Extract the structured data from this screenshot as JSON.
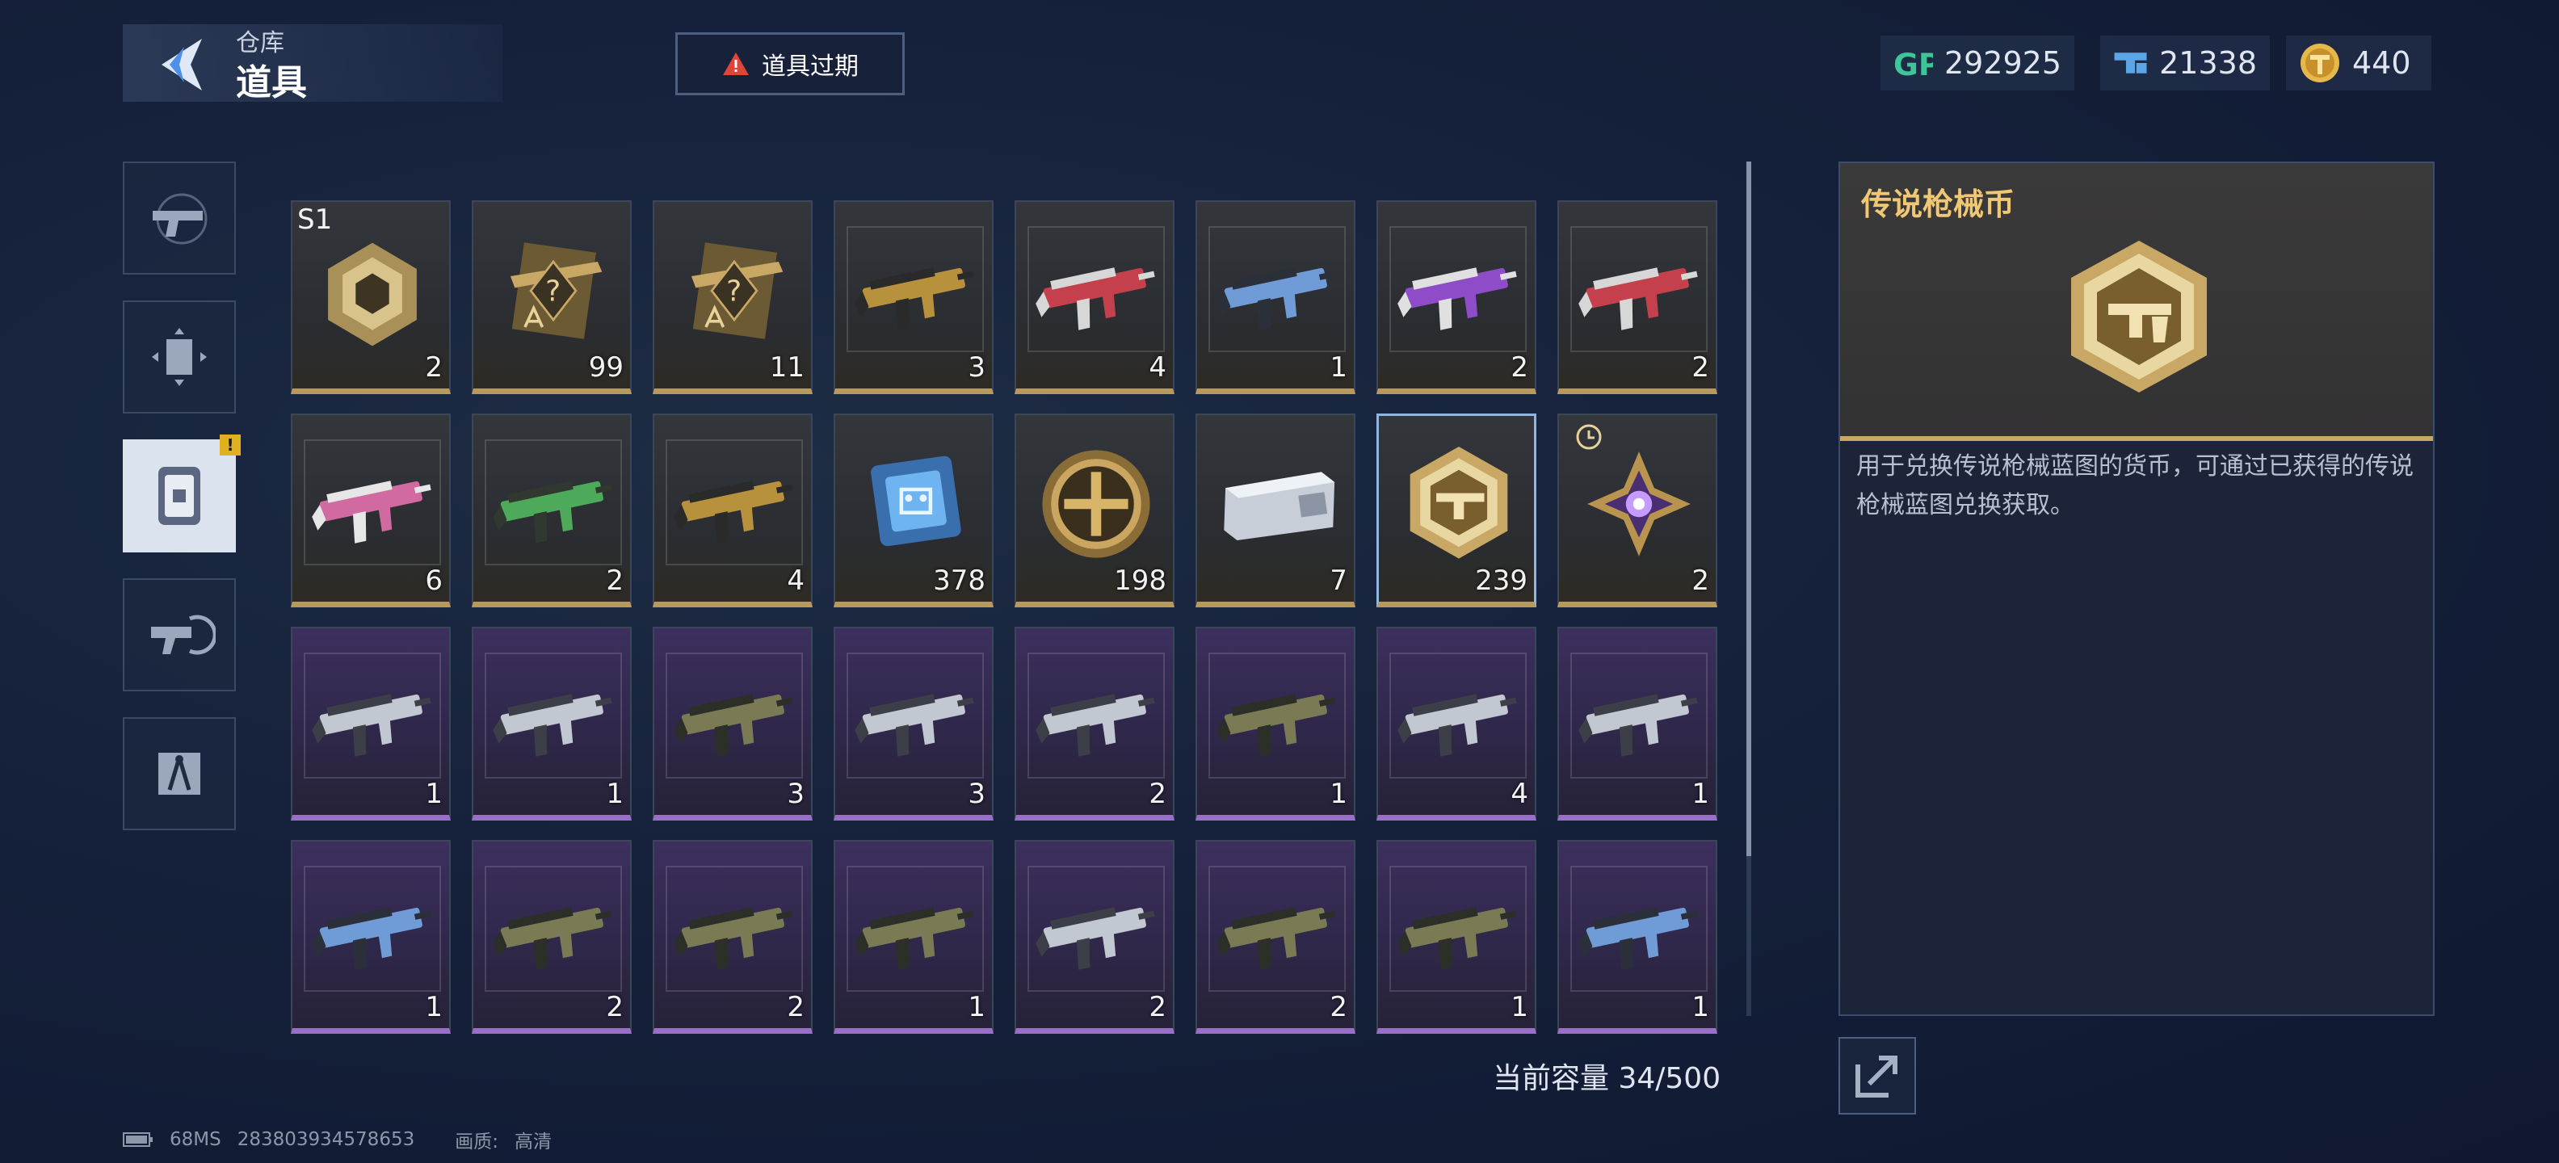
{
  "header": {
    "subtitle": "仓库",
    "title": "道具",
    "expire_button": "道具过期"
  },
  "currencies": [
    {
      "icon": "gp-icon",
      "value": "292925"
    },
    {
      "icon": "ticket-icon",
      "value": "21338"
    },
    {
      "icon": "coin-icon",
      "value": "440"
    }
  ],
  "side_tabs": [
    {
      "name": "weapons",
      "icon": "pistol-icon",
      "active": false
    },
    {
      "name": "frames",
      "icon": "frame-icon",
      "active": false
    },
    {
      "name": "items",
      "icon": "item-card-icon",
      "active": true,
      "badge": "!"
    },
    {
      "name": "mods",
      "icon": "attachment-icon",
      "active": false
    },
    {
      "name": "blueprints",
      "icon": "compass-icon",
      "active": false
    }
  ],
  "items": [
    {
      "qty": "2",
      "rarity": "gold",
      "tag": "S1",
      "art": "crate"
    },
    {
      "qty": "99",
      "rarity": "gold",
      "art": "blueprint"
    },
    {
      "qty": "11",
      "rarity": "gold",
      "art": "blueprint"
    },
    {
      "qty": "3",
      "rarity": "gold",
      "art": "gun-gold"
    },
    {
      "qty": "4",
      "rarity": "gold",
      "art": "gun-red"
    },
    {
      "qty": "1",
      "rarity": "gold",
      "art": "gun-blue"
    },
    {
      "qty": "2",
      "rarity": "gold",
      "art": "gun-purple"
    },
    {
      "qty": "2",
      "rarity": "gold",
      "art": "gun-red"
    },
    {
      "qty": "6",
      "rarity": "gold",
      "art": "gun-pink"
    },
    {
      "qty": "2",
      "rarity": "gold",
      "art": "gun-green"
    },
    {
      "qty": "4",
      "rarity": "gold",
      "art": "gun-gold"
    },
    {
      "qty": "378",
      "rarity": "gold",
      "art": "chip"
    },
    {
      "qty": "198",
      "rarity": "gold",
      "art": "gold-medal"
    },
    {
      "qty": "7",
      "rarity": "gold",
      "art": "silver-case"
    },
    {
      "qty": "239",
      "rarity": "gold",
      "art": "legend-coin",
      "selected": true
    },
    {
      "qty": "2",
      "rarity": "gold",
      "art": "purple-emblem",
      "timed": true
    },
    {
      "qty": "1",
      "rarity": "purple",
      "art": "gun-silver"
    },
    {
      "qty": "1",
      "rarity": "purple",
      "art": "gun-silver"
    },
    {
      "qty": "3",
      "rarity": "purple",
      "art": "gun-olive"
    },
    {
      "qty": "3",
      "rarity": "purple",
      "art": "gun-silver"
    },
    {
      "qty": "2",
      "rarity": "purple",
      "art": "gun-silver"
    },
    {
      "qty": "1",
      "rarity": "purple",
      "art": "gun-olive"
    },
    {
      "qty": "4",
      "rarity": "purple",
      "art": "gun-silver"
    },
    {
      "qty": "1",
      "rarity": "purple",
      "art": "gun-silver"
    },
    {
      "qty": "1",
      "rarity": "purple",
      "art": "gun-blue"
    },
    {
      "qty": "2",
      "rarity": "purple",
      "art": "gun-olive"
    },
    {
      "qty": "2",
      "rarity": "purple",
      "art": "gun-olive"
    },
    {
      "qty": "1",
      "rarity": "purple",
      "art": "gun-olive"
    },
    {
      "qty": "2",
      "rarity": "purple",
      "art": "gun-silver"
    },
    {
      "qty": "2",
      "rarity": "purple",
      "art": "gun-olive"
    },
    {
      "qty": "1",
      "rarity": "purple",
      "art": "gun-olive"
    },
    {
      "qty": "1",
      "rarity": "purple",
      "art": "gun-blue"
    }
  ],
  "capacity": {
    "label": "当前容量 34/500"
  },
  "detail": {
    "name": "传说枪械币",
    "description": "用于兑换传说枪械蓝图的货币，可通过已获得的传说枪械蓝图兑换获取。"
  },
  "status": {
    "ping": "68MS",
    "uid": "283803934578653",
    "quality_label": "画质:",
    "quality_value": "高清"
  },
  "colors": {
    "gold_rarity": "#b89a5e",
    "purple_rarity": "#9b6fc7",
    "detail_title": "#f0c873",
    "gp": "#3fc59a",
    "ticket": "#5aa6e6",
    "coin": "#e6b84a"
  }
}
